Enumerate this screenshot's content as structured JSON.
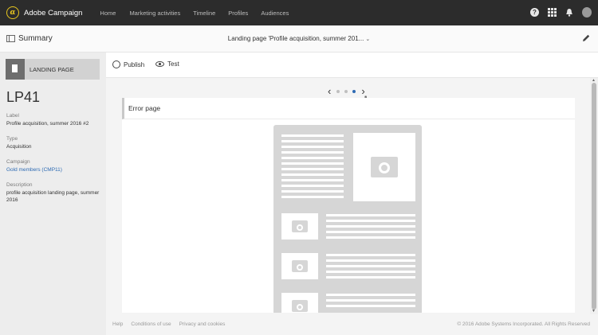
{
  "app": {
    "brand": "Adobe Campaign",
    "logo_glyph": "α",
    "nav": [
      "Home",
      "Marketing activities",
      "Timeline",
      "Profiles",
      "Audiences"
    ],
    "icons": [
      "help-icon",
      "apps-grid-icon",
      "bell-icon",
      "avatar"
    ]
  },
  "summary_bar": {
    "label": "Summary",
    "page_title": "Landing page 'Profile acquisition, summer 201...",
    "chevron": "⌄"
  },
  "left_panel": {
    "badge": "LANDING PAGE",
    "id": "LP41",
    "fields": [
      {
        "label": "Label",
        "value": "Profile acquisition, summer 2016 #2"
      },
      {
        "label": "Type",
        "value": "Acquisition"
      },
      {
        "label": "Campaign",
        "value": "Gold members (CMP11)"
      },
      {
        "label": "Description",
        "value": "profile acquisition landing page, summer 2016"
      }
    ]
  },
  "toolbar": {
    "publish": "Publish",
    "test": "Test"
  },
  "pager": {
    "prev": "‹",
    "next": "›",
    "total_pages": 3,
    "active_page": 3
  },
  "card": {
    "title": "Error page"
  },
  "footer": {
    "links": [
      "Help",
      "Conditions of use",
      "Privacy and cookies"
    ],
    "copyright": "© 2016 Adobe Systems Incorporated. All Rights Reserved"
  },
  "colors": {
    "topbar": "#2c2c2c",
    "accent": "#2d6ab3",
    "logo": "#e8c61f"
  }
}
